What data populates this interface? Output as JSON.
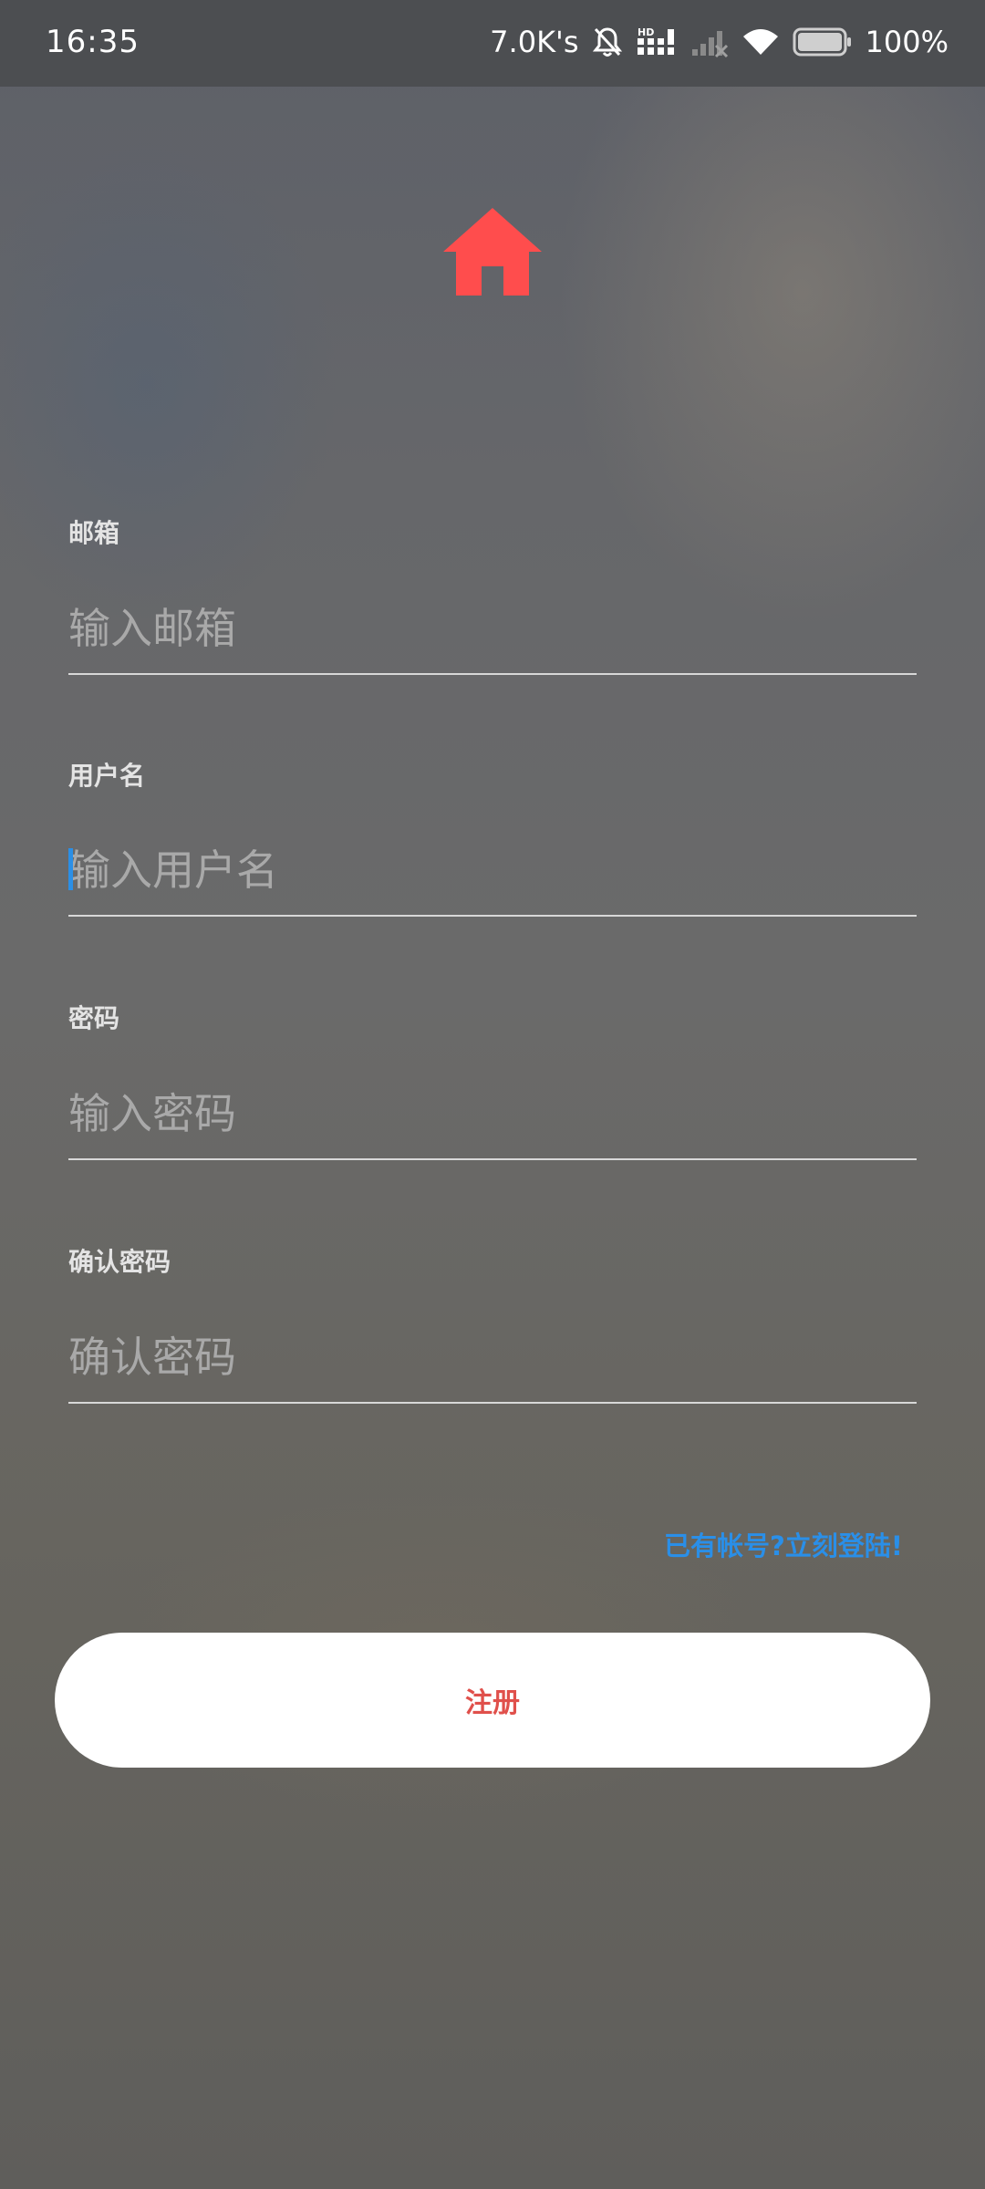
{
  "status_bar": {
    "time": "16:35",
    "network_speed": "7.0K's",
    "battery_percent": "100%",
    "icons": [
      "bell-muted-icon",
      "hd-signal-icon",
      "cellular-signal-icon",
      "wifi-icon",
      "battery-icon"
    ]
  },
  "logo": {
    "icon": "home-icon",
    "color": "#ff4d4d"
  },
  "form": {
    "email": {
      "label": "邮箱",
      "placeholder": "输入邮箱",
      "value": ""
    },
    "username": {
      "label": "用户名",
      "placeholder": "输入用户名",
      "value": ""
    },
    "password": {
      "label": "密码",
      "placeholder": "输入密码",
      "value": ""
    },
    "confirm_password": {
      "label": "确认密码",
      "placeholder": "确认密码",
      "value": ""
    }
  },
  "login_link": "已有帐号?立刻登陆!",
  "register_button": "注册",
  "colors": {
    "accent_red": "#e0504b",
    "link_blue": "#2a8fe8",
    "caret_blue": "#2b8fe6"
  }
}
